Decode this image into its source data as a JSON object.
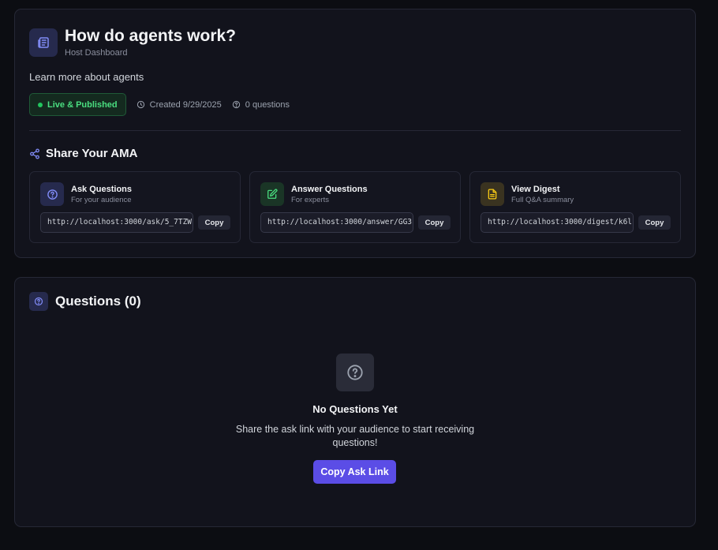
{
  "header": {
    "title": "How do agents work?",
    "subtitle": "Host Dashboard",
    "description": "Learn more about agents",
    "icon": "newspaper-icon"
  },
  "meta": {
    "status": "Live & Published",
    "created": "Created 9/29/2025",
    "questions_count": "0 questions"
  },
  "share": {
    "heading": "Share Your AMA",
    "cards": [
      {
        "title": "Ask Questions",
        "subtitle": "For your audience",
        "url": "http://localhost:3000/ask/5_7TZW",
        "copy_label": "Copy",
        "icon": "question-circle-icon",
        "accent": "#6366f1"
      },
      {
        "title": "Answer Questions",
        "subtitle": "For experts",
        "url": "http://localhost:3000/answer/GG3",
        "copy_label": "Copy",
        "icon": "edit-icon",
        "accent": "#22c55e"
      },
      {
        "title": "View Digest",
        "subtitle": "Full Q&A summary",
        "url": "http://localhost:3000/digest/k6l",
        "copy_label": "Copy",
        "icon": "document-icon",
        "accent": "#eab308"
      }
    ]
  },
  "questions": {
    "heading": "Questions (0)",
    "empty_title": "No Questions Yet",
    "empty_description": "Share the ask link with your audience to start receiving questions!",
    "copy_ask_label": "Copy Ask Link"
  },
  "colors": {
    "background": "#0c0d12",
    "card": "#12131c",
    "primary_button": "#5b4de6",
    "live_green": "#4ade80"
  }
}
